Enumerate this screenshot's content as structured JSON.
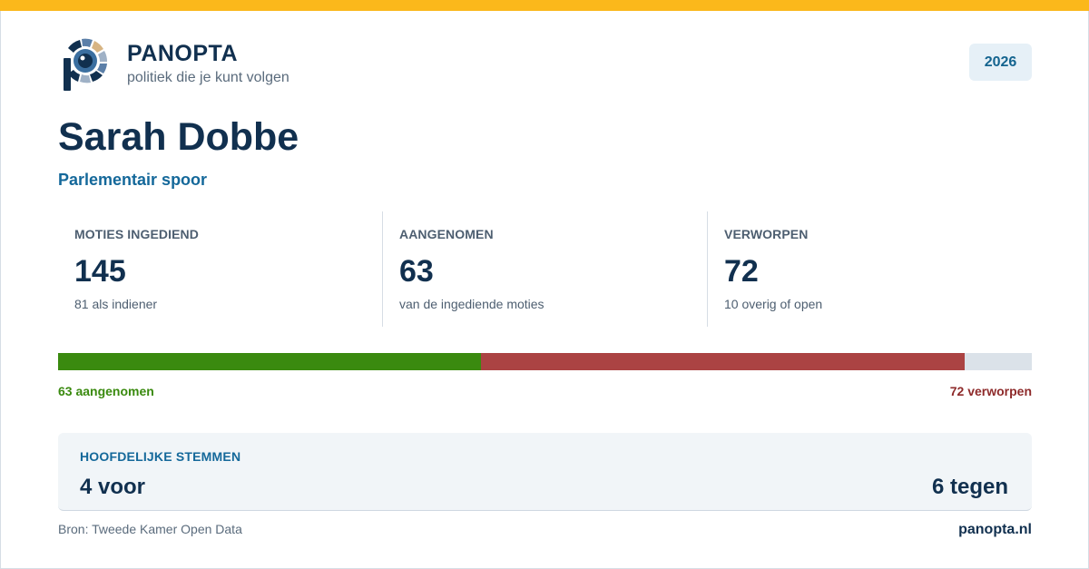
{
  "brand": {
    "name": "PANOPTA",
    "tagline": "politiek die je kunt volgen",
    "logo_icon": "panopta-eye-logo-icon"
  },
  "year_badge": "2026",
  "person": {
    "name": "Sarah Dobbe",
    "subtitle": "Parlementair spoor"
  },
  "stats": [
    {
      "label": "MOTIES INGEDIEND",
      "value": "145",
      "note": "81 als indiener"
    },
    {
      "label": "AANGENOMEN",
      "value": "63",
      "note": "van de ingediende moties"
    },
    {
      "label": "VERWORPEN",
      "value": "72",
      "note": "10 overig of open"
    }
  ],
  "progress": {
    "total": 145,
    "segments": [
      {
        "key": "aangenomen",
        "value": 63,
        "color": "#3a8a0f"
      },
      {
        "key": "verworpen",
        "value": 72,
        "color": "#ab4343"
      }
    ],
    "remainder_color": "#dbe2e9",
    "left_label": "63 aangenomen",
    "right_label": "72 verworpen"
  },
  "votes": {
    "label": "HOOFDELIJKE STEMMEN",
    "for": "4 voor",
    "against": "6 tegen"
  },
  "footer": {
    "source": "Bron: Tweede Kamer Open Data",
    "site": "panopta.nl"
  },
  "colors": {
    "accent_top": "#fbb81b",
    "navy": "#11304f",
    "blue": "#14689a",
    "green": "#3a8a0f",
    "red": "#ab4343"
  }
}
